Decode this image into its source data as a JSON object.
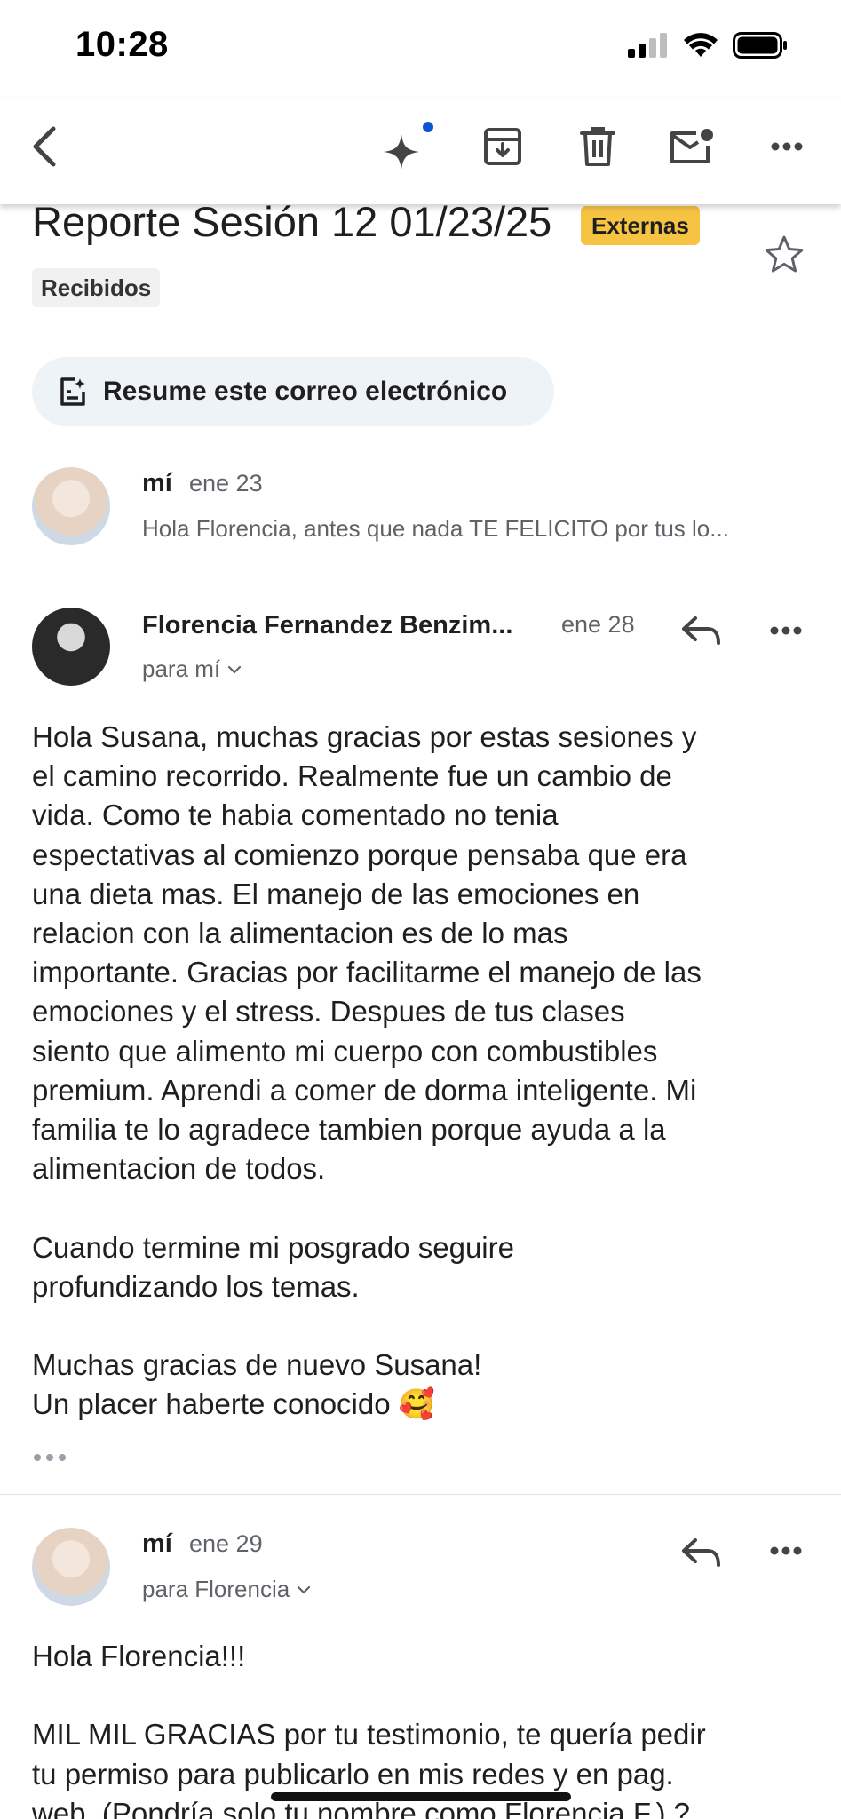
{
  "status_bar": {
    "time": "10:28",
    "icons": [
      "cellular-signal-icon",
      "wifi-icon",
      "battery-icon"
    ]
  },
  "toolbar": {
    "icons": [
      "back-icon",
      "gemini-sparkle-icon",
      "archive-icon",
      "delete-icon",
      "mark-unread-icon",
      "more-icon"
    ],
    "accent": "#0b57d0"
  },
  "thread": {
    "subject": "Reporte Sesión 12 01/23/25",
    "label_externas": "Externas",
    "label_recibidos": "Recibidos",
    "summarize_label": "Resume este correo electrónico"
  },
  "messages": [
    {
      "sender": "mí",
      "date": "ene 23",
      "snippet": "Hola Florencia, antes que nada TE FELICITO por tus lo..."
    },
    {
      "sender": "Florencia Fernandez Benzim...",
      "date": "ene 28",
      "to": "para mí",
      "body": "Hola Susana, muchas gracias por estas sesiones y\nel camino recorrido. Realmente fue un cambio de\nvida. Como te habia comentado no tenia\nespectativas al comienzo porque pensaba que era\nuna dieta mas. El manejo de las emociones en\nrelacion con la alimentacion es de lo mas\nimportante. Gracias por facilitarme el manejo de las\nemociones y el stress. Despues de tus clases\nsiento que alimento mi cuerpo con combustibles\npremium. Aprendi a comer de dorma inteligente. Mi\nfamilia te lo agradece tambien porque ayuda a la\nalimentacion de todos.\n\nCuando termine mi posgrado seguire\nprofundizando los temas.\n\nMuchas gracias de nuevo Susana!\nUn placer haberte conocido 🥰"
    },
    {
      "sender": "mí",
      "date": "ene 29",
      "to": "para Florencia",
      "body": "Hola Florencia!!!\n\nMIL MIL GRACIAS por tu testimonio, te quería pedir\ntu permiso para publicarlo en mis redes y en pag.\nweb. (Pondría solo tu nombre como Florencia F.) ?"
    }
  ]
}
